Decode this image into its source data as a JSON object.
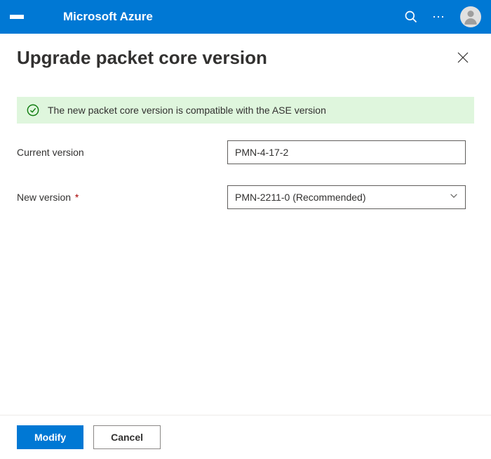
{
  "topbar": {
    "brand": "Microsoft Azure"
  },
  "panel": {
    "title": "Upgrade packet core version"
  },
  "notification": {
    "message": "The new packet core version is compatible with the ASE version",
    "status_color": "#107c10",
    "bg_color": "#dff6dd"
  },
  "fields": {
    "current_version": {
      "label": "Current version",
      "value": "PMN-4-17-2"
    },
    "new_version": {
      "label": "New version",
      "required_marker": "*",
      "value": "PMN-2211-0 (Recommended)"
    }
  },
  "footer": {
    "primary": "Modify",
    "secondary": "Cancel"
  },
  "colors": {
    "azure_blue": "#0078d4"
  }
}
